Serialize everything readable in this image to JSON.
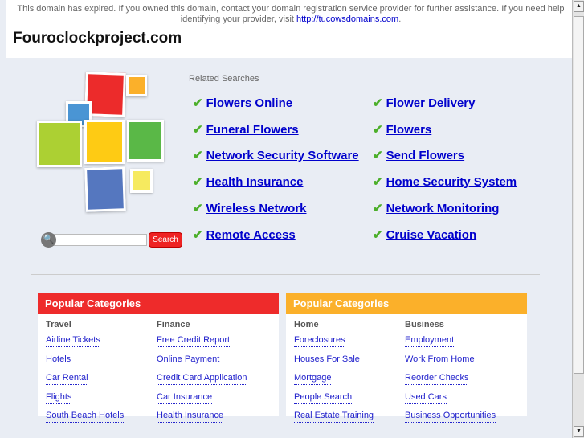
{
  "notice": {
    "text": "This domain has expired. If you owned this domain, contact your domain registration service provider for further assistance. If you need help identifying your provider, visit ",
    "link": "http://tucowsdomains.com",
    "suffix": "."
  },
  "domain_title": "Fouroclockproject.com",
  "logo_colors": {
    "red": "#ec2b2b",
    "orange": "#fbb02a",
    "blue_small": "#4a95d4",
    "lime": "#acd033",
    "yellow": "#fecb14",
    "green": "#5ab847",
    "blue": "#5577bf",
    "yellow_small": "#f6ea5f"
  },
  "related": {
    "label": "Related Searches",
    "links": [
      "Flowers Online",
      "Flower Delivery",
      "Funeral Flowers",
      "Flowers",
      "Network Security Software",
      "Send Flowers",
      "Health Insurance",
      "Home Security System",
      "Wireless Network",
      "Network Monitoring",
      "Remote Access",
      "Cruise Vacation"
    ]
  },
  "search": {
    "button": "Search",
    "value": ""
  },
  "categories": [
    {
      "title": "Popular Categories",
      "color": "#ee2b2b",
      "columns": [
        {
          "heading": "Travel",
          "links": [
            "Airline Tickets",
            "Hotels",
            "Car Rental",
            "Flights",
            "South Beach Hotels"
          ]
        },
        {
          "heading": "Finance",
          "links": [
            "Free Credit Report",
            "Online Payment",
            "Credit Card Application",
            "Car Insurance",
            "Health Insurance"
          ]
        }
      ]
    },
    {
      "title": "Popular Categories",
      "color": "#fbb02a",
      "columns": [
        {
          "heading": "Home",
          "links": [
            "Foreclosures",
            "Houses For Sale",
            "Mortgage",
            "People Search",
            "Real Estate Training"
          ]
        },
        {
          "heading": "Business",
          "links": [
            "Employment",
            "Work From Home",
            "Reorder Checks",
            "Used Cars",
            "Business Opportunities"
          ]
        }
      ]
    }
  ]
}
